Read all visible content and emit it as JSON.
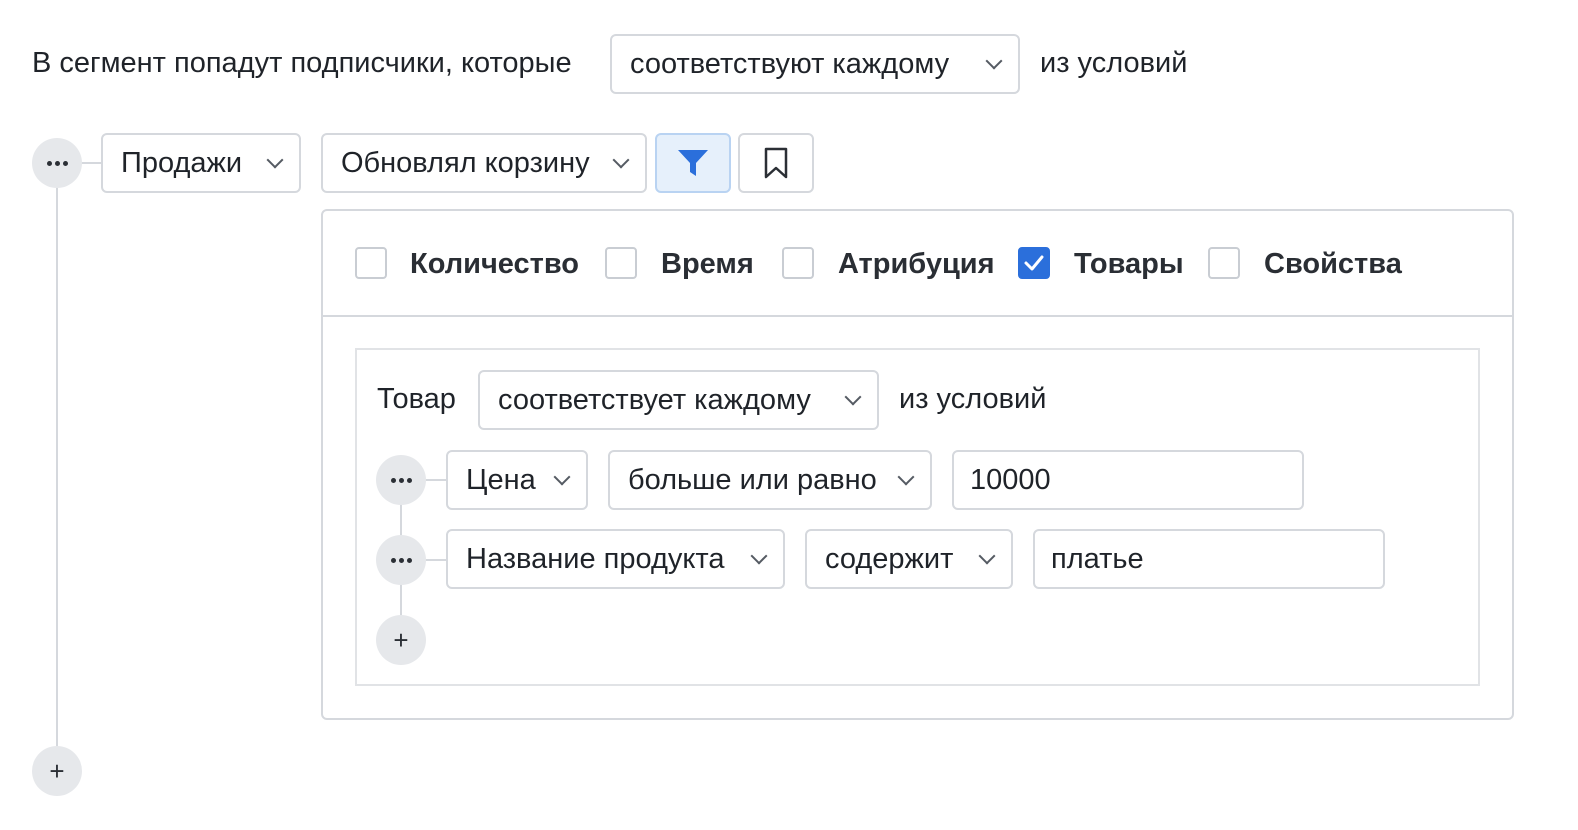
{
  "segment_rule": {
    "prefix": "В сегмент попадут подписчики, которые",
    "match_value": "соответствуют каждому",
    "suffix": "из условий"
  },
  "condition": {
    "category": "Продажи",
    "event": "Обновлял корзину",
    "filter_icon": "filter-icon",
    "bookmark_icon": "bookmark-icon"
  },
  "filter_tabs": [
    {
      "label": "Количество",
      "checked": false
    },
    {
      "label": "Время",
      "checked": false
    },
    {
      "label": "Атрибуция",
      "checked": false
    },
    {
      "label": "Товары",
      "checked": true
    },
    {
      "label": "Свойства",
      "checked": false
    }
  ],
  "product_rule": {
    "prefix": "Товар",
    "match_value": "соответствует каждому",
    "suffix": "из условий",
    "rows": [
      {
        "field": "Цена",
        "operator": "больше или равно",
        "value": "10000"
      },
      {
        "field": "Название продукта",
        "operator": "содержит",
        "value": "платье"
      }
    ]
  },
  "colors": {
    "accent": "#2b6fdb",
    "border": "#d5d8dd",
    "circle_bg": "#e6e8eb"
  }
}
